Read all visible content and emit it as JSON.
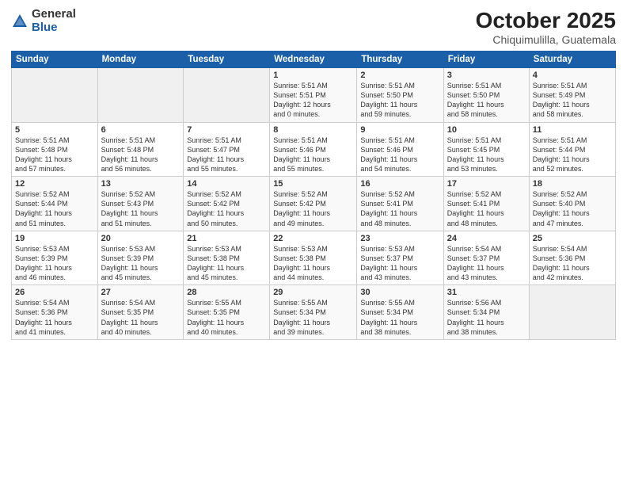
{
  "logo": {
    "general": "General",
    "blue": "Blue"
  },
  "title": {
    "month": "October 2025",
    "location": "Chiquimulilla, Guatemala"
  },
  "weekdays": [
    "Sunday",
    "Monday",
    "Tuesday",
    "Wednesday",
    "Thursday",
    "Friday",
    "Saturday"
  ],
  "weeks": [
    [
      {
        "num": "",
        "info": ""
      },
      {
        "num": "",
        "info": ""
      },
      {
        "num": "",
        "info": ""
      },
      {
        "num": "1",
        "info": "Sunrise: 5:51 AM\nSunset: 5:51 PM\nDaylight: 12 hours\nand 0 minutes."
      },
      {
        "num": "2",
        "info": "Sunrise: 5:51 AM\nSunset: 5:50 PM\nDaylight: 11 hours\nand 59 minutes."
      },
      {
        "num": "3",
        "info": "Sunrise: 5:51 AM\nSunset: 5:50 PM\nDaylight: 11 hours\nand 58 minutes."
      },
      {
        "num": "4",
        "info": "Sunrise: 5:51 AM\nSunset: 5:49 PM\nDaylight: 11 hours\nand 58 minutes."
      }
    ],
    [
      {
        "num": "5",
        "info": "Sunrise: 5:51 AM\nSunset: 5:48 PM\nDaylight: 11 hours\nand 57 minutes."
      },
      {
        "num": "6",
        "info": "Sunrise: 5:51 AM\nSunset: 5:48 PM\nDaylight: 11 hours\nand 56 minutes."
      },
      {
        "num": "7",
        "info": "Sunrise: 5:51 AM\nSunset: 5:47 PM\nDaylight: 11 hours\nand 55 minutes."
      },
      {
        "num": "8",
        "info": "Sunrise: 5:51 AM\nSunset: 5:46 PM\nDaylight: 11 hours\nand 55 minutes."
      },
      {
        "num": "9",
        "info": "Sunrise: 5:51 AM\nSunset: 5:46 PM\nDaylight: 11 hours\nand 54 minutes."
      },
      {
        "num": "10",
        "info": "Sunrise: 5:51 AM\nSunset: 5:45 PM\nDaylight: 11 hours\nand 53 minutes."
      },
      {
        "num": "11",
        "info": "Sunrise: 5:51 AM\nSunset: 5:44 PM\nDaylight: 11 hours\nand 52 minutes."
      }
    ],
    [
      {
        "num": "12",
        "info": "Sunrise: 5:52 AM\nSunset: 5:44 PM\nDaylight: 11 hours\nand 51 minutes."
      },
      {
        "num": "13",
        "info": "Sunrise: 5:52 AM\nSunset: 5:43 PM\nDaylight: 11 hours\nand 51 minutes."
      },
      {
        "num": "14",
        "info": "Sunrise: 5:52 AM\nSunset: 5:42 PM\nDaylight: 11 hours\nand 50 minutes."
      },
      {
        "num": "15",
        "info": "Sunrise: 5:52 AM\nSunset: 5:42 PM\nDaylight: 11 hours\nand 49 minutes."
      },
      {
        "num": "16",
        "info": "Sunrise: 5:52 AM\nSunset: 5:41 PM\nDaylight: 11 hours\nand 48 minutes."
      },
      {
        "num": "17",
        "info": "Sunrise: 5:52 AM\nSunset: 5:41 PM\nDaylight: 11 hours\nand 48 minutes."
      },
      {
        "num": "18",
        "info": "Sunrise: 5:52 AM\nSunset: 5:40 PM\nDaylight: 11 hours\nand 47 minutes."
      }
    ],
    [
      {
        "num": "19",
        "info": "Sunrise: 5:53 AM\nSunset: 5:39 PM\nDaylight: 11 hours\nand 46 minutes."
      },
      {
        "num": "20",
        "info": "Sunrise: 5:53 AM\nSunset: 5:39 PM\nDaylight: 11 hours\nand 45 minutes."
      },
      {
        "num": "21",
        "info": "Sunrise: 5:53 AM\nSunset: 5:38 PM\nDaylight: 11 hours\nand 45 minutes."
      },
      {
        "num": "22",
        "info": "Sunrise: 5:53 AM\nSunset: 5:38 PM\nDaylight: 11 hours\nand 44 minutes."
      },
      {
        "num": "23",
        "info": "Sunrise: 5:53 AM\nSunset: 5:37 PM\nDaylight: 11 hours\nand 43 minutes."
      },
      {
        "num": "24",
        "info": "Sunrise: 5:54 AM\nSunset: 5:37 PM\nDaylight: 11 hours\nand 43 minutes."
      },
      {
        "num": "25",
        "info": "Sunrise: 5:54 AM\nSunset: 5:36 PM\nDaylight: 11 hours\nand 42 minutes."
      }
    ],
    [
      {
        "num": "26",
        "info": "Sunrise: 5:54 AM\nSunset: 5:36 PM\nDaylight: 11 hours\nand 41 minutes."
      },
      {
        "num": "27",
        "info": "Sunrise: 5:54 AM\nSunset: 5:35 PM\nDaylight: 11 hours\nand 40 minutes."
      },
      {
        "num": "28",
        "info": "Sunrise: 5:55 AM\nSunset: 5:35 PM\nDaylight: 11 hours\nand 40 minutes."
      },
      {
        "num": "29",
        "info": "Sunrise: 5:55 AM\nSunset: 5:34 PM\nDaylight: 11 hours\nand 39 minutes."
      },
      {
        "num": "30",
        "info": "Sunrise: 5:55 AM\nSunset: 5:34 PM\nDaylight: 11 hours\nand 38 minutes."
      },
      {
        "num": "31",
        "info": "Sunrise: 5:56 AM\nSunset: 5:34 PM\nDaylight: 11 hours\nand 38 minutes."
      },
      {
        "num": "",
        "info": ""
      }
    ]
  ]
}
